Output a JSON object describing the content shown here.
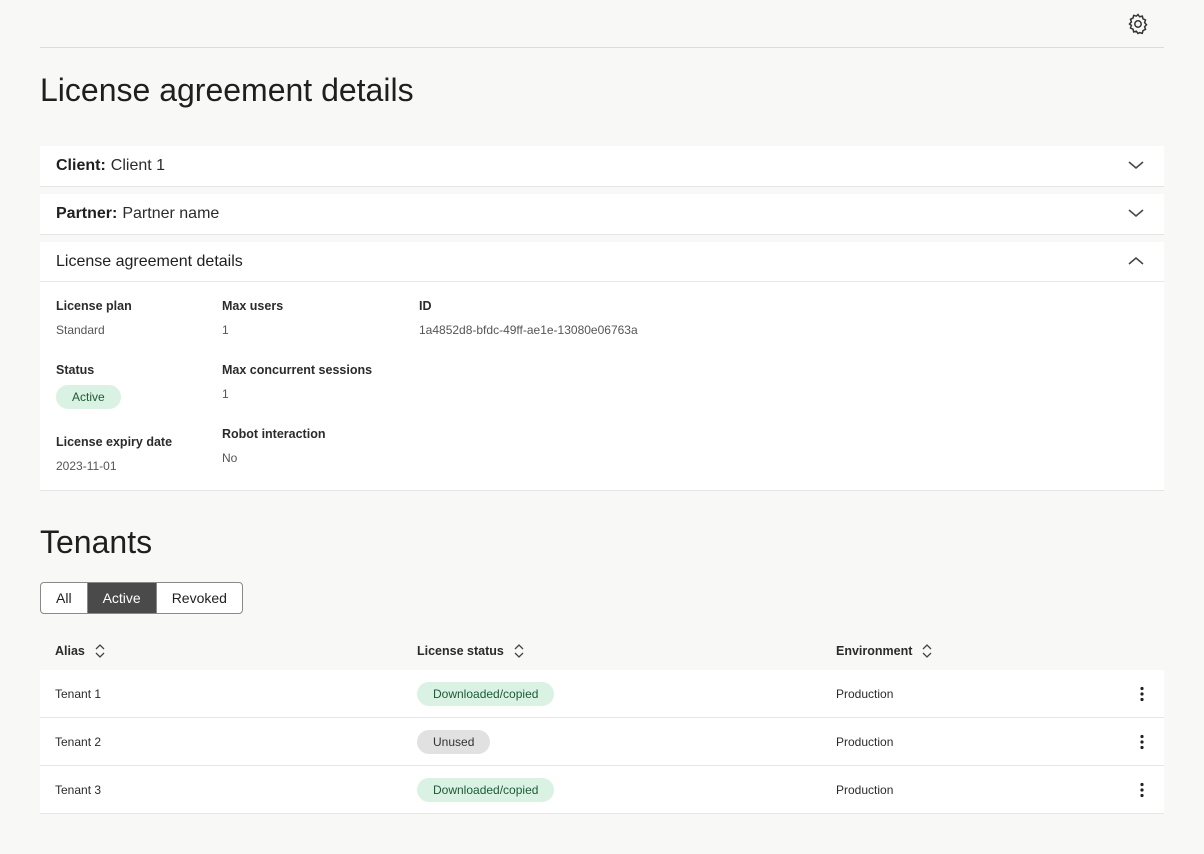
{
  "header": {
    "settings_icon": "gear-icon"
  },
  "page_title": "License agreement details",
  "accordions": [
    {
      "key": "Client:",
      "value": "Client 1",
      "expanded": false
    },
    {
      "key": "Partner:",
      "value": "Partner name",
      "expanded": false
    },
    {
      "key": "License agreement details",
      "value": "",
      "expanded": true
    }
  ],
  "details": {
    "license_plan": {
      "label": "License plan",
      "value": "Standard"
    },
    "status": {
      "label": "Status",
      "value": "Active"
    },
    "license_expiry": {
      "label": "License expiry date",
      "value": "2023-11-01"
    },
    "max_users": {
      "label": "Max users",
      "value": "1"
    },
    "max_sessions": {
      "label": "Max concurrent sessions",
      "value": "1"
    },
    "robot_interaction": {
      "label": "Robot interaction",
      "value": "No"
    },
    "id": {
      "label": "ID",
      "value": "1a4852d8-bfdc-49ff-ae1e-13080e06763a"
    }
  },
  "tenants": {
    "title": "Tenants",
    "filters": [
      "All",
      "Active",
      "Revoked"
    ],
    "active_filter": "Active",
    "columns": [
      "Alias",
      "License status",
      "Environment"
    ],
    "rows": [
      {
        "alias": "Tenant 1",
        "status": "Downloaded/copied",
        "environment": "Production"
      },
      {
        "alias": "Tenant 2",
        "status": "Unused",
        "environment": "Production"
      },
      {
        "alias": "Tenant 3",
        "status": "Downloaded/copied",
        "environment": "Production"
      }
    ]
  },
  "colors": {
    "accent_dark": "#4a4a4a",
    "badge_green_bg": "#daf2e3",
    "badge_grey_bg": "#e1e1e1"
  }
}
